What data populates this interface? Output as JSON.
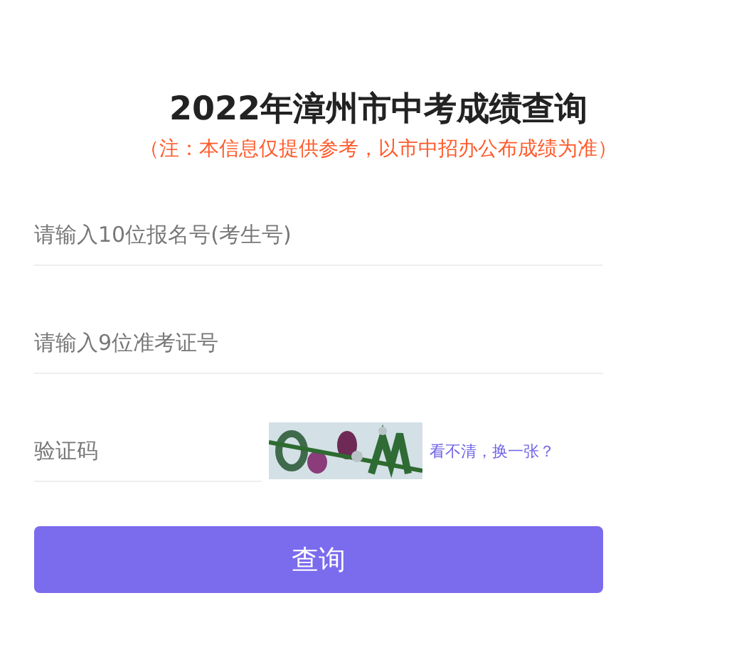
{
  "title": "2022年漳州市中考成绩查询",
  "notice": "（注：本信息仅提供参考，以市中招办公布成绩为准）",
  "fields": [
    {
      "placeholder": "请输入10位报名号(考生号)"
    },
    {
      "placeholder": "请输入9位准考证号"
    }
  ],
  "captcha": {
    "placeholder": "验证码",
    "refresh_link": "看不清，换一张？"
  },
  "submit_button": "查询"
}
